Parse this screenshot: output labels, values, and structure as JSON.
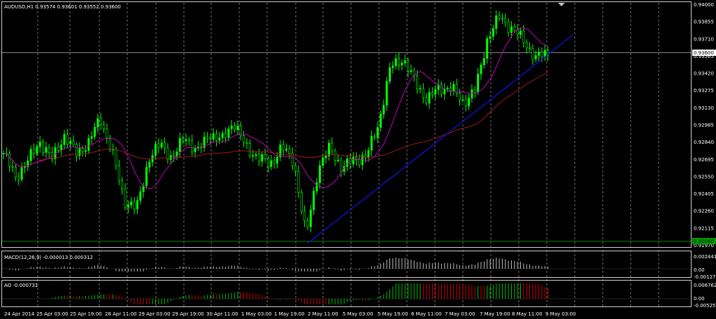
{
  "colors": {
    "background": "#000000",
    "bull_candle": "#00ff00",
    "bear_candle": "#00ff00",
    "grid": "#c0c0c0",
    "ma_fast": "#c000c0",
    "ma_slow": "#a01818",
    "trendline": "#1010d0",
    "support": "#00a000",
    "macd_hist": "#c0c0c0",
    "macd_signal": "#c00000",
    "ao_up": "#00c000",
    "ao_down": "#d00000"
  },
  "main": {
    "header": "AUDUSD,H1  0.93574 0.93601 0.93552 0.93600",
    "price_labels": [
      "0.94000",
      "0.93855",
      "0.93710",
      "0.93565",
      "0.93420",
      "0.93275",
      "0.93130",
      "0.92985",
      "0.92840",
      "0.92695",
      "0.92550",
      "0.92405",
      "0.92260",
      "0.92115",
      "0.91970"
    ],
    "current_price": "0.93600",
    "support_price": "0.92040"
  },
  "macd": {
    "header": "MACD(12,26,9) -0.000013 0.000312",
    "labels": [
      "0.002441",
      "0.00",
      "-0.00127"
    ]
  },
  "ao": {
    "header": "AO -0.000731",
    "labels": [
      "0.006762",
      "0.00",
      "-0.00525"
    ]
  },
  "time_labels": [
    "24 Apr 2014",
    "25 Apr 03:00",
    "25 Apr 19:00",
    "28 Apr 11:00",
    "29 Apr 03:00",
    "29 Apr 19:00",
    "30 Apr 11:00",
    "1 May 03:00",
    "1 May 19:00",
    "2 May 11:00",
    "5 May 03:00",
    "5 May 19:00",
    "6 May 11:00",
    "7 May 03:00",
    "7 May 19:00",
    "8 May 11:00",
    "9 May 03:00"
  ],
  "chart_data": [
    {
      "type": "candlestick",
      "title": "AUDUSD,H1",
      "ylim": [
        0.9197,
        0.94
      ],
      "anchors_close": [
        0.9275,
        0.9255,
        0.9268,
        0.9285,
        0.927,
        0.929,
        0.9275,
        0.9283,
        0.9305,
        0.9275,
        0.9235,
        0.9228,
        0.927,
        0.9283,
        0.927,
        0.929,
        0.9275,
        0.9292,
        0.9285,
        0.9302,
        0.928,
        0.9272,
        0.9265,
        0.928,
        0.9268,
        0.9205,
        0.9262,
        0.928,
        0.9262,
        0.927,
        0.9272,
        0.93,
        0.9348,
        0.9355,
        0.9335,
        0.932,
        0.933,
        0.933,
        0.9318,
        0.9328,
        0.9372,
        0.939,
        0.938,
        0.937,
        0.9355,
        0.936
      ],
      "candle_count": 180
    },
    {
      "type": "bar",
      "title": "MACD(12,26,9)",
      "ylim": [
        -0.00127,
        0.002441
      ]
    },
    {
      "type": "bar",
      "title": "AO",
      "ylim": [
        -0.00525,
        0.006762
      ]
    }
  ]
}
